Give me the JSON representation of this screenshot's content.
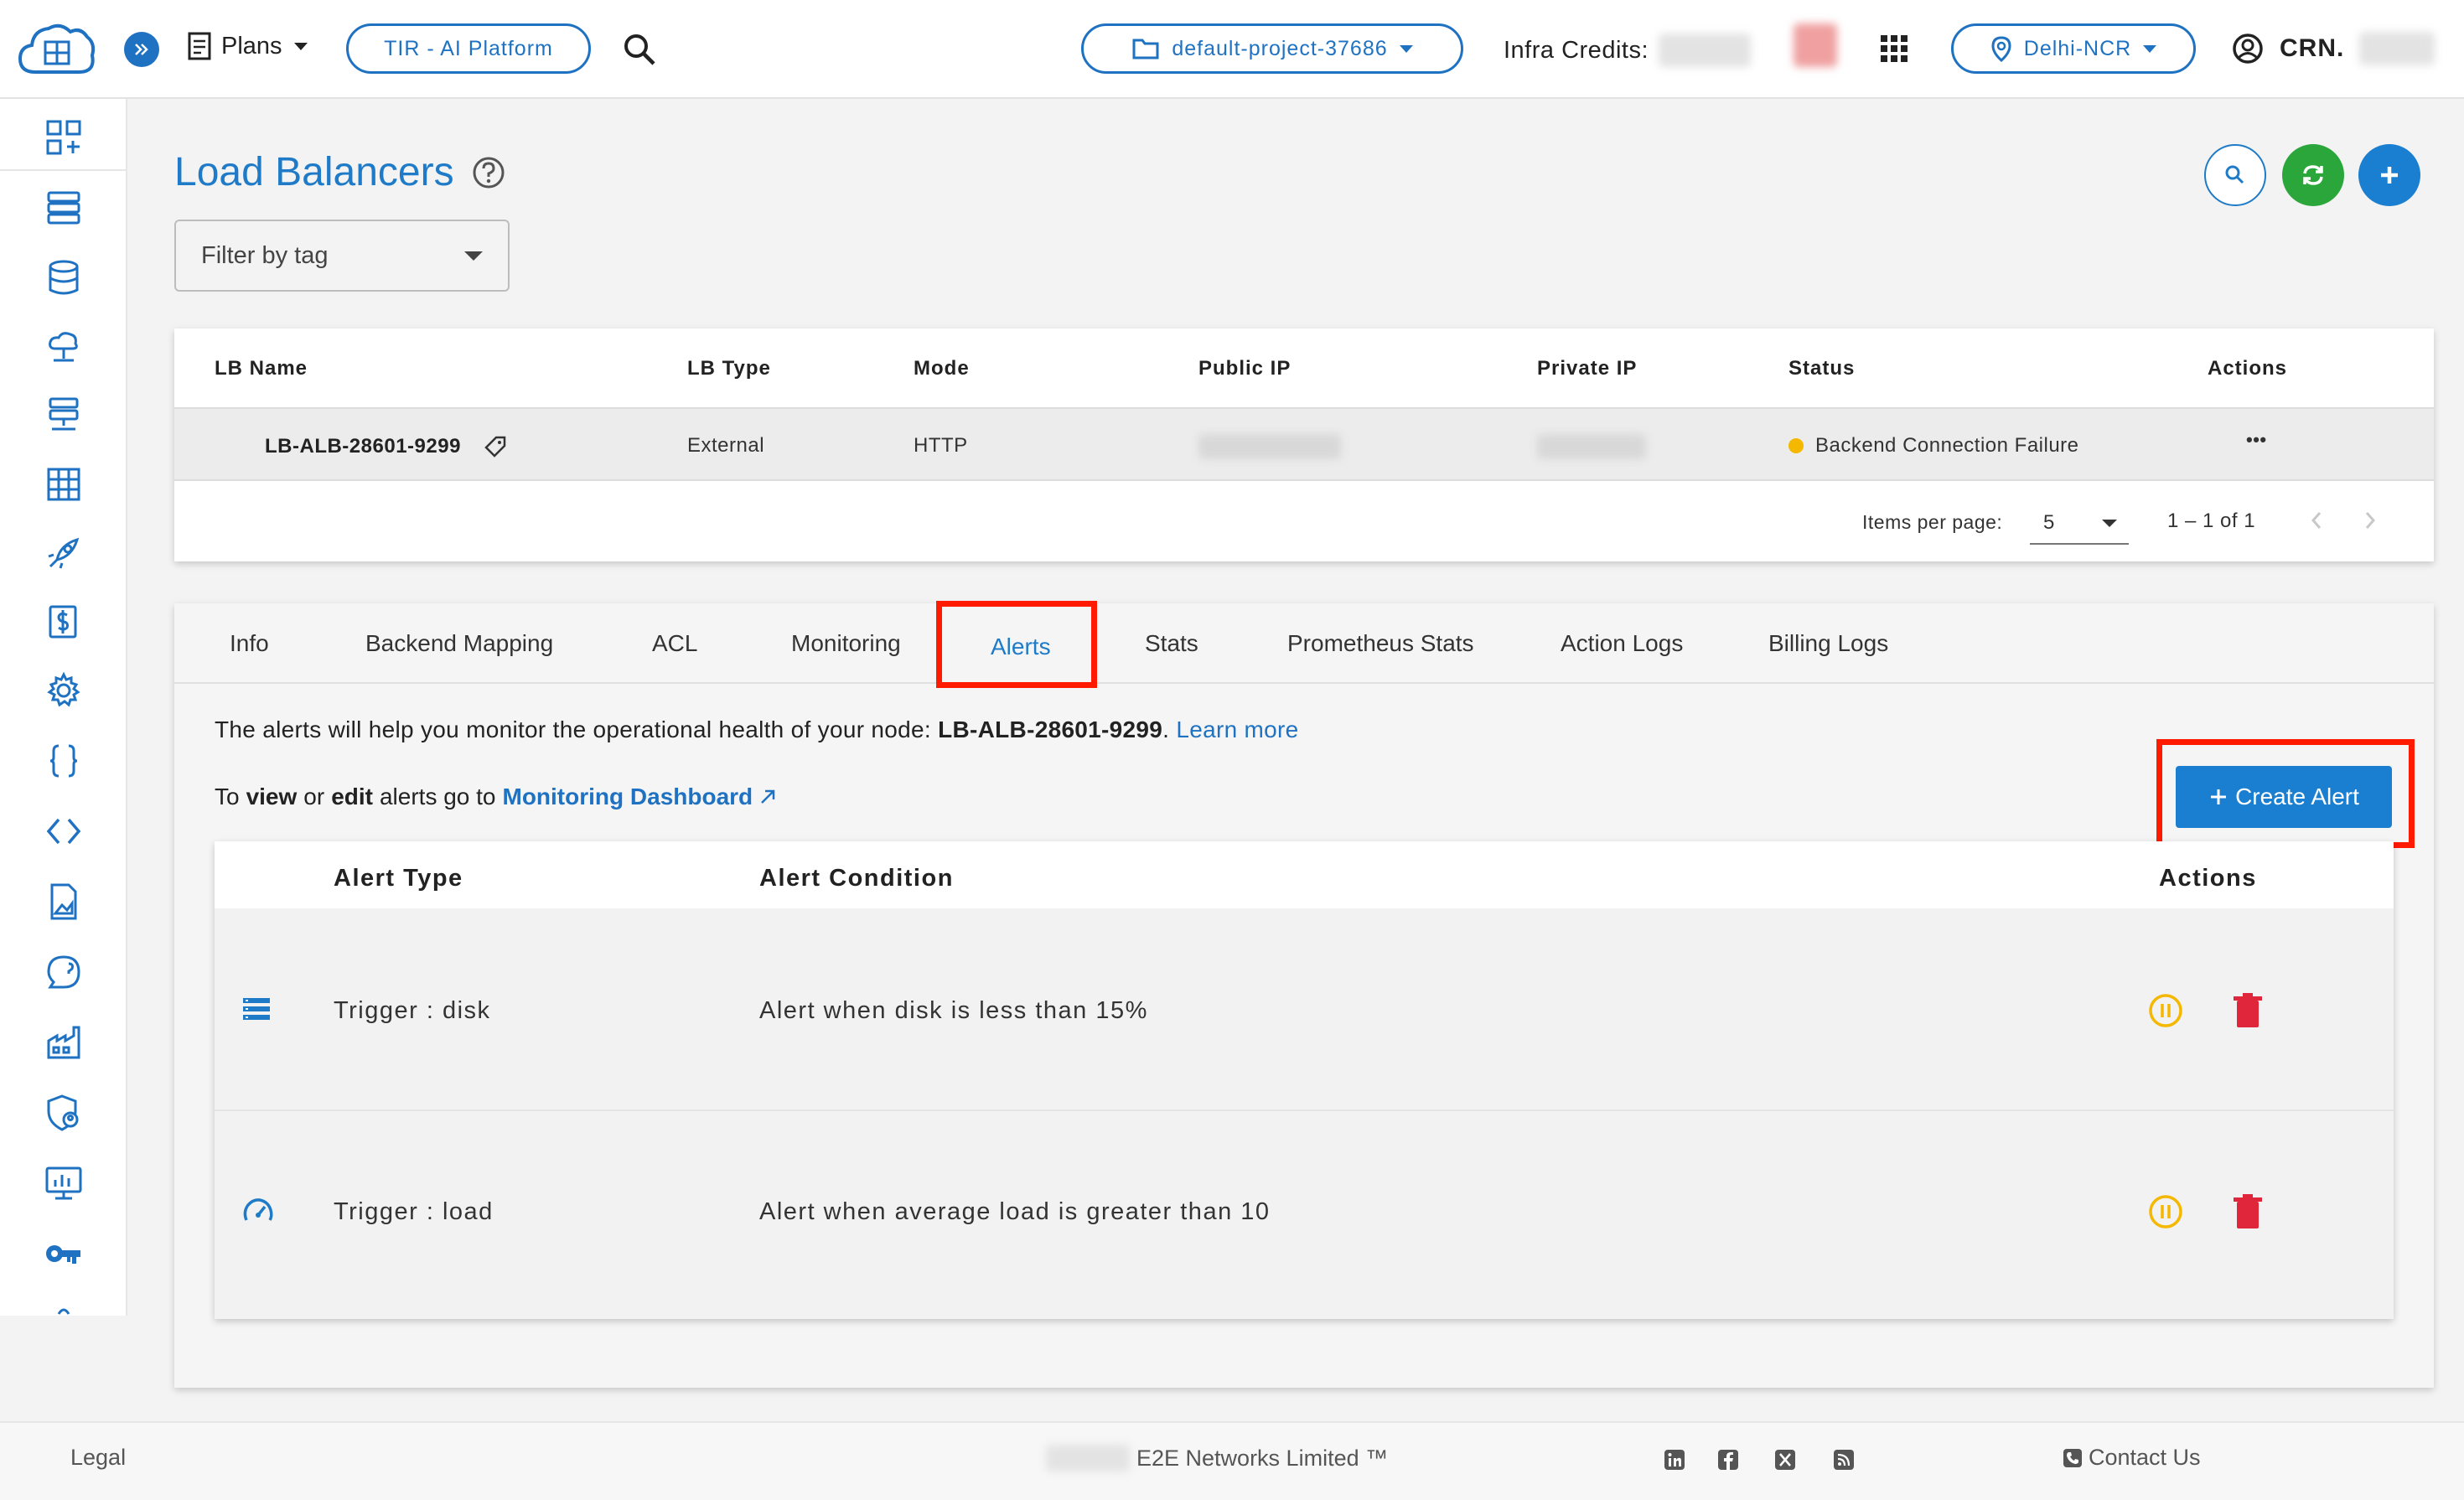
{
  "header": {
    "plans_label": "Plans",
    "tir_label": "TIR - AI Platform",
    "project_label": "default-project-37686",
    "infra_credits_label": "Infra Credits:",
    "region_label": "Delhi-NCR",
    "user_label": "CRN."
  },
  "page": {
    "title": "Load Balancers",
    "filter_placeholder": "Filter by tag"
  },
  "lb_table": {
    "columns": [
      "LB Name",
      "LB Type",
      "Mode",
      "Public IP",
      "Private IP",
      "Status",
      "Actions"
    ],
    "rows": [
      {
        "name": "LB-ALB-28601-9299",
        "type": "External",
        "mode": "HTTP",
        "status": "Backend Connection Failure",
        "actions": "•••"
      }
    ],
    "status_color": "#f5b800",
    "items_per_page_label": "Items per page:",
    "items_per_page_value": "5",
    "range": "1 – 1 of 1"
  },
  "tabs": [
    "Info",
    "Backend Mapping",
    "ACL",
    "Monitoring",
    "Alerts",
    "Stats",
    "Prometheus Stats",
    "Action Logs",
    "Billing Logs"
  ],
  "active_tab": "Alerts",
  "alerts": {
    "intro_text": "The alerts will help you monitor the operational health of your node:",
    "node_name": "LB-ALB-28601-9299",
    "learn_more": "Learn more",
    "line2_to": "To",
    "line2_view": "view",
    "line2_or": "or",
    "line2_edit": "edit",
    "line2_rest": "alerts go to",
    "dashboard_link": "Monitoring Dashboard",
    "create_button": "Create Alert",
    "columns": [
      "Alert Type",
      "Alert Condition",
      "Actions"
    ],
    "rows": [
      {
        "icon": "list-icon",
        "type": "Trigger : disk",
        "condition": "Alert when disk is less than 15%"
      },
      {
        "icon": "speedometer-icon",
        "type": "Trigger : load",
        "condition": "Alert when average load is greater than 10"
      }
    ]
  },
  "footer": {
    "legal": "Legal",
    "company": "E2E Networks Limited ™",
    "contact": "Contact Us"
  },
  "colors": {
    "primary": "#1f7bc7",
    "green": "#2aa63a",
    "highlight": "#ff1a00",
    "pause": "#f5b800",
    "delete": "#e0263a"
  }
}
